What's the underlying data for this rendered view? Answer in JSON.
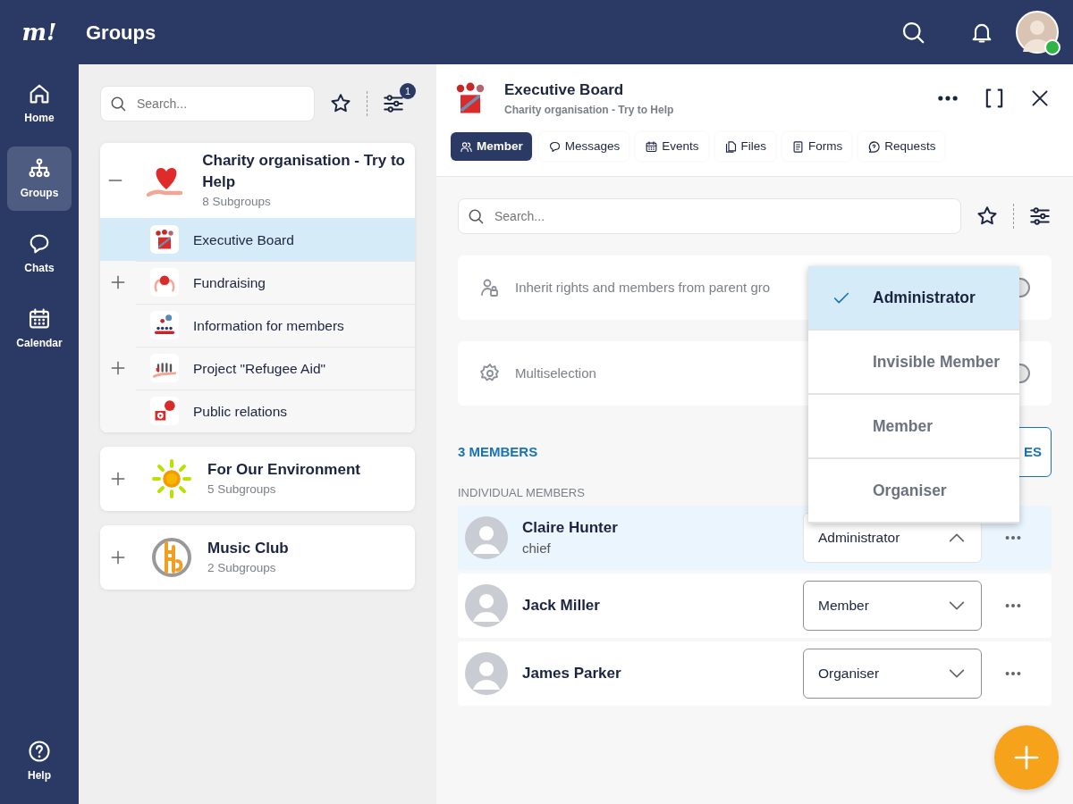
{
  "app": {
    "logo": "m!",
    "title": "Groups"
  },
  "nav": [
    {
      "label": "Home",
      "selected": false
    },
    {
      "label": "Groups",
      "selected": true
    },
    {
      "label": "Chats",
      "selected": false
    },
    {
      "label": "Calendar",
      "selected": false
    }
  ],
  "help": {
    "label": "Help"
  },
  "group_list": {
    "search": {
      "placeholder": "Search..."
    },
    "filter_count": "1",
    "groups": [
      {
        "name": "Charity organisation - Try to Help",
        "subtitle": "8 Subgroups",
        "expanded": true,
        "children": [
          {
            "name": "Executive Board",
            "selected": true,
            "has_children": false
          },
          {
            "name": "Fundraising",
            "selected": false,
            "has_children": true
          },
          {
            "name": "Information for members",
            "selected": false,
            "has_children": false
          },
          {
            "name": "Project \"Refugee Aid\"",
            "selected": false,
            "has_children": true
          },
          {
            "name": "Public relations",
            "selected": false,
            "has_children": false
          }
        ]
      },
      {
        "name": "For Our Environment",
        "subtitle": "5 Subgroups",
        "expanded": false
      },
      {
        "name": "Music Club",
        "subtitle": "2 Subgroups",
        "expanded": false
      }
    ]
  },
  "detail": {
    "title": "Executive Board",
    "subtitle": "Charity organisation - Try to Help",
    "tabs": [
      {
        "label": "Member",
        "selected": true
      },
      {
        "label": "Messages",
        "selected": false
      },
      {
        "label": "Events",
        "selected": false
      },
      {
        "label": "Files",
        "selected": false
      },
      {
        "label": "Forms",
        "selected": false
      },
      {
        "label": "Requests",
        "selected": false
      }
    ],
    "search": {
      "placeholder": "Search..."
    },
    "settings": [
      {
        "label": "Inherit rights and members from parent gro",
        "on": false
      },
      {
        "label": "Multiselection",
        "on": false
      }
    ],
    "members_count": "3 MEMBERS",
    "members_button": "ES",
    "section_label": "INDIVIDUAL MEMBERS",
    "members": [
      {
        "name": "Claire Hunter",
        "note": "chief",
        "role": "Administrator",
        "open": true,
        "selected": true
      },
      {
        "name": "Jack Miller",
        "role": "Member",
        "open": false,
        "selected": false
      },
      {
        "name": "James Parker",
        "role": "Organiser",
        "open": false,
        "selected": false
      }
    ],
    "role_menu": [
      {
        "label": "Administrator",
        "selected": true
      },
      {
        "label": "Invisible Member",
        "selected": false
      },
      {
        "label": "Member",
        "selected": false
      },
      {
        "label": "Organiser",
        "selected": false
      }
    ]
  }
}
